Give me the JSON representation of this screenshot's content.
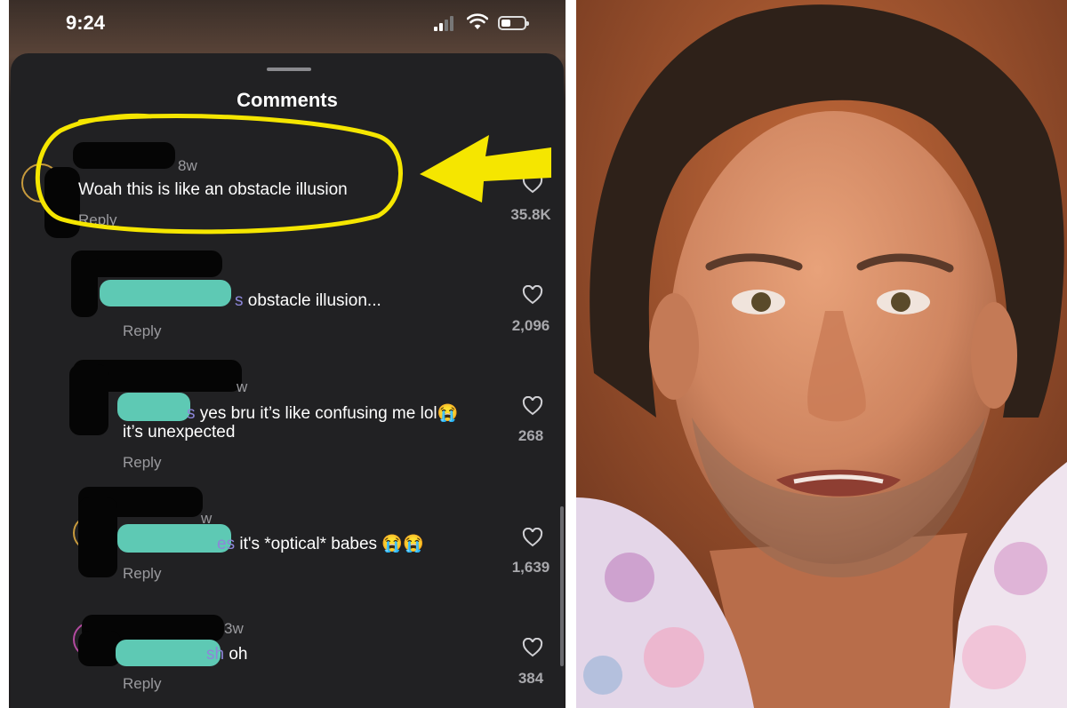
{
  "status_bar": {
    "time": "9:24"
  },
  "sheet": {
    "title": "Comments"
  },
  "comments": [
    {
      "time": "8w",
      "text": "Woah this is like an obstacle illusion",
      "reply": "Reply",
      "likes": "35.8K"
    },
    {
      "mention": "s",
      "text": " obstacle illusion...",
      "reply": "Reply",
      "likes": "2,096"
    },
    {
      "time": "w",
      "mention": "s",
      "text": " yes bru it’s like confusing me lol😭",
      "text2": "it’s unexpected",
      "reply": "Reply",
      "likes": "268"
    },
    {
      "time": "w",
      "mention": "es",
      "text": " it's *optical* babes 😭😭",
      "reply": "Reply",
      "likes": "1,639"
    },
    {
      "time": "3w",
      "mention": "sh",
      "text": " oh",
      "reply": "Reply",
      "likes": "384"
    }
  ],
  "colors": {
    "highlight": "#f5e600",
    "mention": "#8d86d9",
    "sheet_bg": "#212123"
  },
  "icons": {
    "heart": "heart-outline-icon",
    "wifi": "wifi-icon",
    "battery": "battery-icon",
    "signal": "cellular-signal-icon"
  }
}
